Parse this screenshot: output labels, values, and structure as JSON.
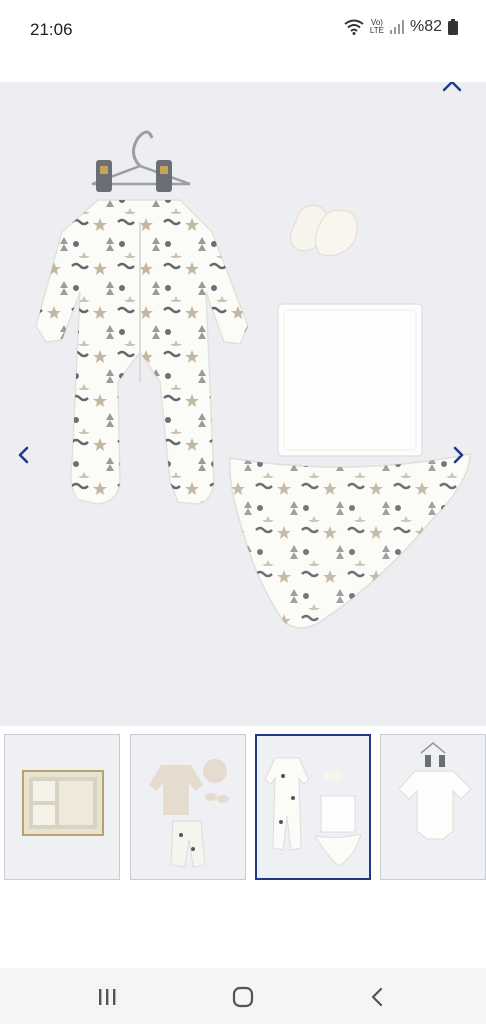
{
  "status_bar": {
    "time": "21:06",
    "network_top": "Vo)",
    "network_bottom": "LTE",
    "battery": "%82"
  },
  "viewer": {
    "close_icon": "close-icon",
    "prev_icon": "chevron-left-icon",
    "next_icon": "chevron-right-icon",
    "accent": "#1f3a8a"
  },
  "thumbnails": [
    {
      "name": "gift-box-set"
    },
    {
      "name": "beige-set"
    },
    {
      "name": "white-set",
      "active": true
    },
    {
      "name": "bodysuit"
    }
  ],
  "system_nav": {
    "recents_icon": "recents-icon",
    "home_icon": "home-icon",
    "back_icon": "back-icon"
  }
}
